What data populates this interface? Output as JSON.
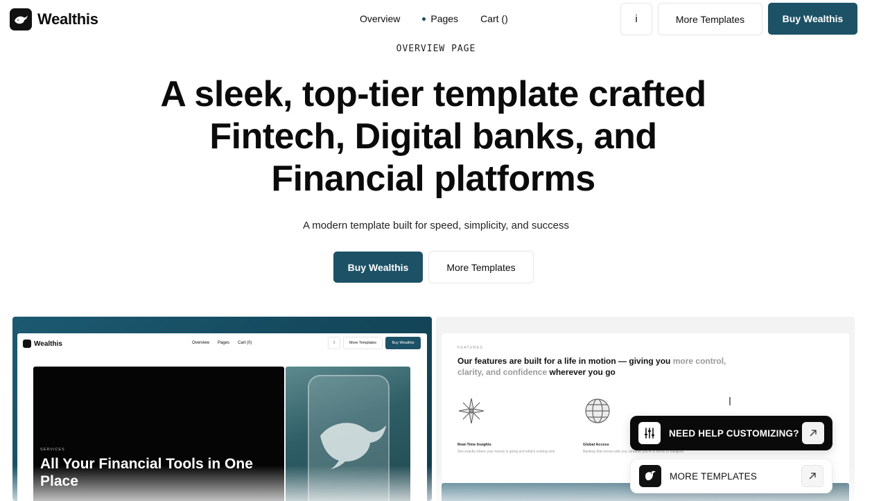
{
  "header": {
    "brand": "Wealthis",
    "nav": [
      "Overview",
      "Pages",
      "Cart ()"
    ],
    "info_label": "i",
    "more_templates": "More Templates",
    "buy": "Buy Wealthis"
  },
  "hero": {
    "eyebrow": "OVERVIEW PAGE",
    "headline_lines": [
      "A sleek, top-tier template crafted",
      "Fintech, Digital banks, and",
      "Financial platforms"
    ],
    "subline": "A modern template built for speed, simplicity, and success",
    "buy": "Buy Wealthis",
    "more": "More Templates"
  },
  "preview_left": {
    "brand": "Wealthis",
    "nav": [
      "Overview",
      "Pages",
      "Cart (0)"
    ],
    "info": "i",
    "more": "More Templates",
    "buy": "Buy Wealthis",
    "eyebrow": "SERVICES",
    "headline": "All Your Financial Tools in One Place"
  },
  "preview_right": {
    "eyebrow": "FEATURES",
    "headline_dark": "Our features are built for a life in motion — giving you",
    "headline_muted": "more control, clarity, and confidence",
    "headline_end": "wherever you go",
    "features": [
      {
        "title": "Real-Time Insights",
        "desc": "See exactly where your money is going and what's coming next"
      },
      {
        "title": "Global Access",
        "desc": "Banking that moves with you, whether you're in Berlin or Bangkok"
      }
    ]
  },
  "widgets": {
    "help": "NEED HELP CUSTOMIZING?",
    "more": "MORE TEMPLATES"
  },
  "colors": {
    "accent": "#1d5266",
    "text": "#0b0b0b"
  }
}
